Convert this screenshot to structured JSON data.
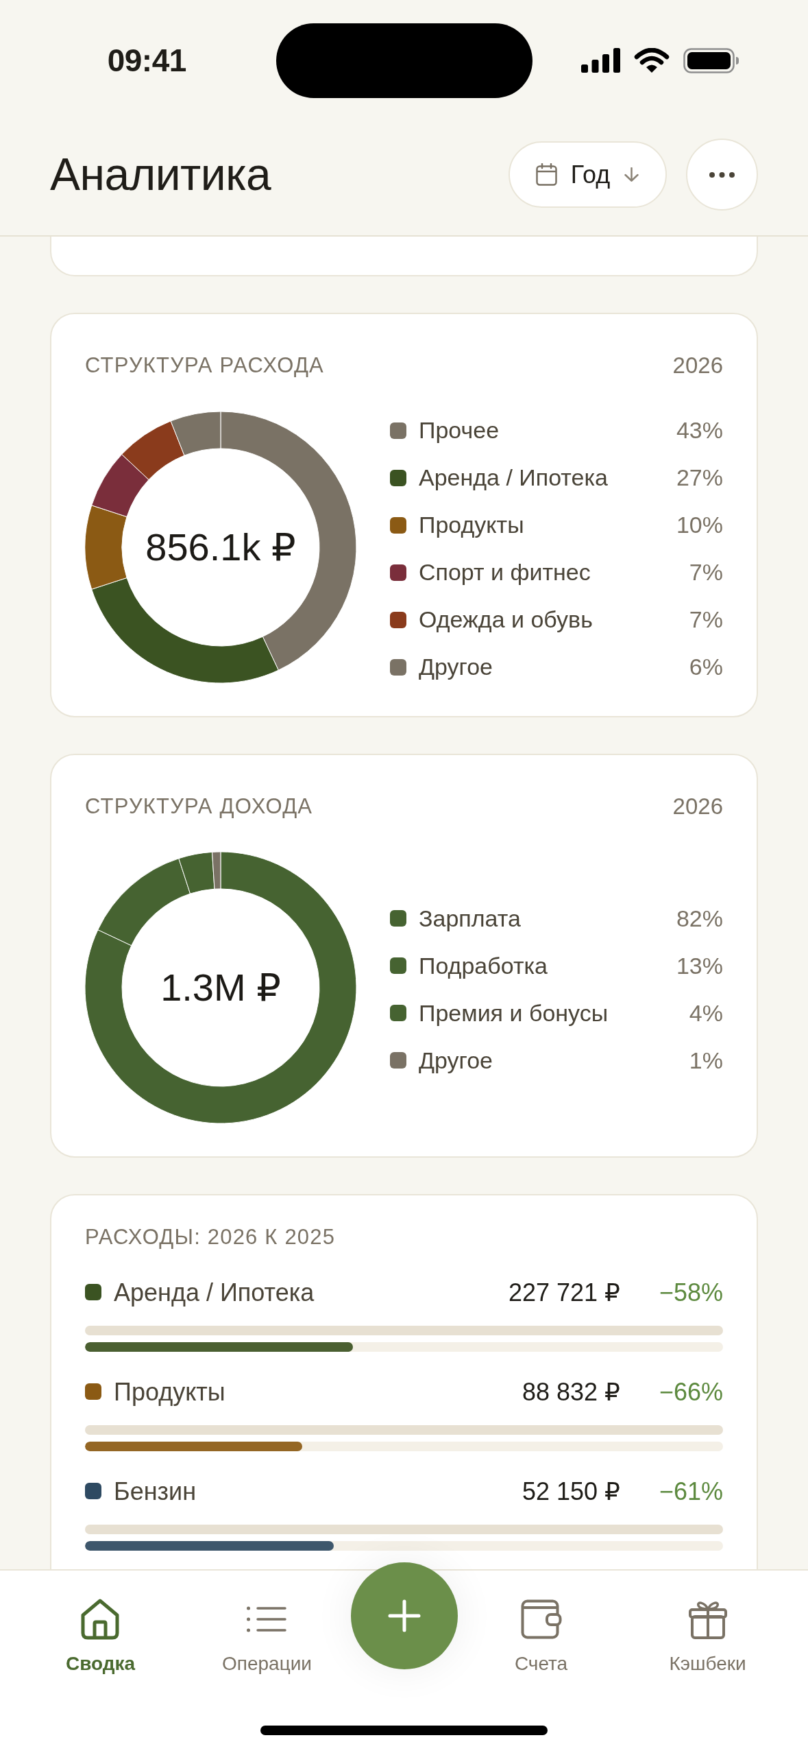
{
  "status_bar": {
    "time": "09:41"
  },
  "header": {
    "title": "Аналитика",
    "period": {
      "label": "Год"
    }
  },
  "expense_structure": {
    "title": "СТРУКТУРА РАСХОДА",
    "year": "2026",
    "total": "856.1k ₽",
    "chart_data": {
      "type": "donut",
      "categories": [
        "Прочее",
        "Аренда / Ипотека",
        "Продукты",
        "Спорт и фитнес",
        "Одежда и обувь",
        "Другое"
      ],
      "values": [
        43,
        27,
        10,
        7,
        7,
        6
      ]
    },
    "legend": [
      {
        "share": "43%",
        "color": "#7a7265"
      },
      {
        "share": "27%",
        "color": "#3b5322"
      },
      {
        "share": "10%",
        "color": "#8b5a14"
      },
      {
        "share": "7%",
        "color": "#7a2e3b"
      },
      {
        "share": "7%",
        "color": "#8a3b1c"
      },
      {
        "share": "6%",
        "color": "#7a7265"
      }
    ]
  },
  "income_structure": {
    "title": "СТРУКТУРА ДОХОДА",
    "year": "2026",
    "total": "1.3M ₽",
    "chart_data": {
      "type": "donut",
      "categories": [
        "Зарплата",
        "Подработка",
        "Премия и бонусы",
        "Другое"
      ],
      "values": [
        82,
        13,
        4,
        1
      ]
    },
    "legend": [
      {
        "share": "82%",
        "color": "#466331"
      },
      {
        "share": "13%",
        "color": "#466331"
      },
      {
        "share": "4%",
        "color": "#466331"
      },
      {
        "share": "1%",
        "color": "#7a7265"
      }
    ]
  },
  "expense_comparison": {
    "title": "РАСХОДЫ: 2026 К 2025",
    "rows": [
      {
        "label": "Аренда / Ипотека",
        "amount": "227 721 ₽",
        "change": "−58%",
        "color": "#3b5322",
        "level": 0.42
      },
      {
        "label": "Продукты",
        "amount": "88 832 ₽",
        "change": "−66%",
        "color": "#8b5a14",
        "level": 0.34
      },
      {
        "label": "Бензин",
        "amount": "52 150 ₽",
        "change": "−61%",
        "color": "#2e4a62",
        "level": 0.39
      }
    ]
  },
  "bottom_nav": {
    "tabs": [
      {
        "label": "Сводка",
        "selected": true
      },
      {
        "label": "Операции",
        "selected": false
      },
      {
        "label": "Счета",
        "selected": false
      },
      {
        "label": "Кэшбеки",
        "selected": false
      }
    ]
  }
}
